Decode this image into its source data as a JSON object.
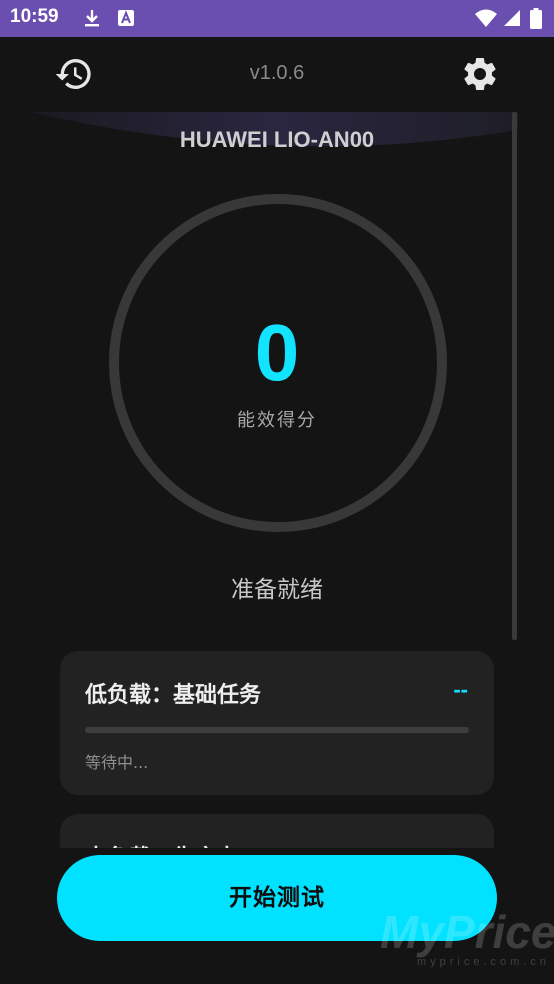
{
  "status_bar": {
    "time": "10:59",
    "icons": [
      "download-icon",
      "app-notification-icon",
      "wifi-icon",
      "signal-icon",
      "battery-icon"
    ]
  },
  "header": {
    "history_icon": "history-icon",
    "version": "v1.0.6",
    "settings_icon": "gear-icon"
  },
  "device": {
    "name": "HUAWEI LIO-AN00"
  },
  "score": {
    "value": "0",
    "label": "能效得分",
    "color": "#12e3ff"
  },
  "status_text": "准备就绪",
  "tasks": [
    {
      "title": "低负载：基础任务",
      "value": "--",
      "progress": 0,
      "status": "等待中..."
    },
    {
      "title": "中负载：生产力"
    }
  ],
  "start_button": {
    "label": "开始测试"
  },
  "watermark": {
    "main": "MyPrice",
    "sub": "myprice.com.cn"
  },
  "colors": {
    "accent": "#00e2ff",
    "background": "#141414",
    "status_bar": "#6a4fb0"
  }
}
